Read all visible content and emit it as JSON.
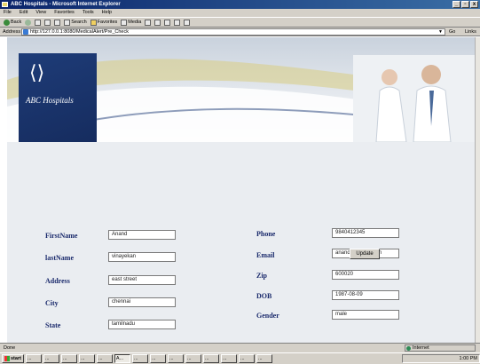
{
  "window": {
    "title": "ABC Hospitals - Microsoft Internet Explorer",
    "min": "_",
    "max": "▫",
    "close": "x"
  },
  "menu": [
    "File",
    "Edit",
    "View",
    "Favorites",
    "Tools",
    "Help"
  ],
  "toolbar": {
    "back": "Back",
    "search": "Search",
    "favorites": "Favorites",
    "media": "Media"
  },
  "address": {
    "label": "Address",
    "url": "http://127.0.0.1:8080/MedicalAlert/Pre_Check",
    "go": "Go",
    "links": "Links"
  },
  "banner": {
    "logo_text": "ABC Hospitals"
  },
  "form": {
    "left": [
      {
        "label": "FirstName",
        "value": "Anand"
      },
      {
        "label": "lastName",
        "value": "vinayekan"
      },
      {
        "label": "Address",
        "value": "east street"
      },
      {
        "label": "City",
        "value": "chennai"
      },
      {
        "label": "State",
        "value": "tamilnadu"
      }
    ],
    "right": [
      {
        "label": "Phone",
        "value": "9840412345"
      },
      {
        "label": "Email",
        "value": "anand@yahoo.com"
      },
      {
        "label": "Zip",
        "value": "600020"
      },
      {
        "label": "DOB",
        "value": "1987-08-09"
      },
      {
        "label": "Gender",
        "value": "male"
      }
    ],
    "submit": "Update"
  },
  "status": {
    "text": "Done",
    "zone": "Internet"
  },
  "taskbar": {
    "start": "start",
    "tasks": [
      "...",
      "...",
      "...",
      "...",
      "...",
      "A...",
      "...",
      "...",
      "...",
      "...",
      "...",
      "...",
      "...",
      "..."
    ],
    "clock": "1:00 PM"
  }
}
